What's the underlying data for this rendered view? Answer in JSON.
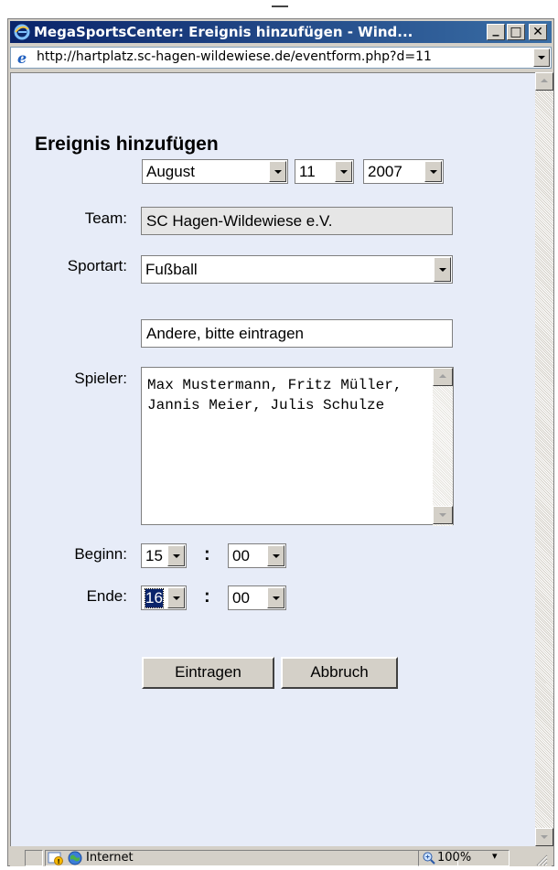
{
  "window": {
    "title": "MegaSportsCenter: Ereignis hinzufügen - Wind...",
    "caption_buttons": {
      "minimize": "_",
      "maximize": "□",
      "close": "✕"
    }
  },
  "address_bar": {
    "url": "http://hartplatz.sc-hagen-wildewiese.de/eventform.php?d=11"
  },
  "form": {
    "heading": "Ereignis hinzufügen",
    "date": {
      "month": "August",
      "day": "11",
      "year": "2007"
    },
    "team_label": "Team:",
    "team_value": "SC Hagen-Wildewiese e.V.",
    "sport_label": "Sportart:",
    "sport_value": "Fußball",
    "other_sport_value": "Andere, bitte eintragen",
    "players_label": "Spieler:",
    "players_value": "Max Mustermann, Fritz Müller, Jannis Meier, Julis Schulze",
    "begin_label": "Beginn:",
    "begin_hour": "15",
    "begin_minute": "00",
    "end_label": "Ende:",
    "end_hour": "16",
    "end_minute": "00",
    "time_separator": ":",
    "submit_label": "Eintragen",
    "cancel_label": "Abbruch"
  },
  "status_bar": {
    "zone": "Internet",
    "zoom": "100%"
  },
  "colors": {
    "titlebar_start": "#0a246a",
    "titlebar_end": "#3a6ea5",
    "content_bg": "#e7ecf8",
    "selection": "#0a246a"
  }
}
